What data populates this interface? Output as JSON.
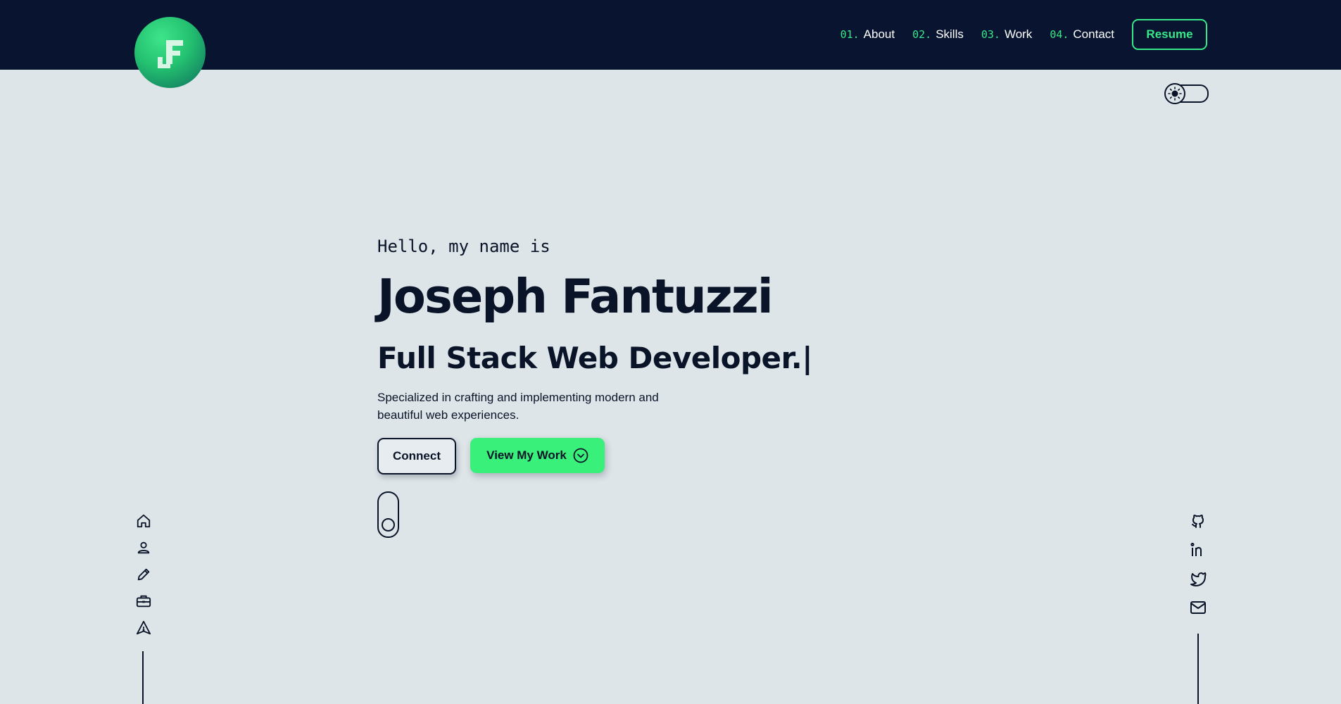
{
  "header": {
    "logo_letter": "F",
    "nav": [
      {
        "num": "01",
        "label": "About"
      },
      {
        "num": "02",
        "label": "Skills"
      },
      {
        "num": "03",
        "label": "Work"
      },
      {
        "num": "04",
        "label": "Contact"
      }
    ],
    "resume_label": "Resume"
  },
  "hero": {
    "greeting": "Hello, my name is",
    "name": "Joseph Fantuzzi",
    "role": "Full Stack Web Developer.|",
    "description": "Specialized in crafting and implementing modern and beautiful web experiences.",
    "connect_label": "Connect",
    "work_label": "View My Work"
  },
  "sidebar_left": [
    "home-icon",
    "user-icon",
    "pencil-icon",
    "briefcase-icon",
    "send-icon"
  ],
  "sidebar_right": [
    "github-icon",
    "linkedin-icon",
    "twitter-icon",
    "mail-icon"
  ],
  "colors": {
    "navy": "#091530",
    "accent": "#37e889",
    "background": "#dee5e9",
    "text": "#0a1428",
    "button_green": "#39f07a"
  }
}
